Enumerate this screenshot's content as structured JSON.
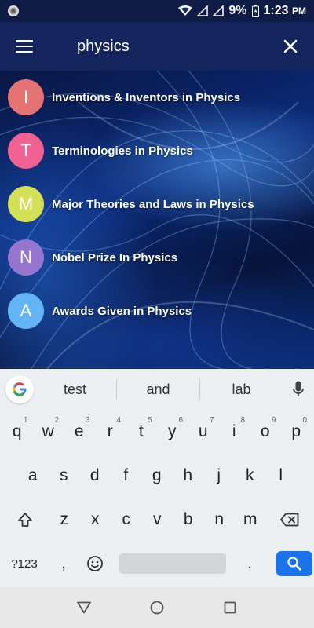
{
  "status_bar": {
    "battery": "9%",
    "time": "1:23",
    "ampm": "PM"
  },
  "app_bar": {
    "search_query": "physics"
  },
  "results": [
    {
      "letter": "I",
      "label": "Inventions & Inventors in Physics",
      "color": "#e57373"
    },
    {
      "letter": "T",
      "label": "Terminologies in Physics",
      "color": "#f06292"
    },
    {
      "letter": "M",
      "label": "Major Theories and Laws in Physics",
      "color": "#d4e157"
    },
    {
      "letter": "N",
      "label": "Nobel Prize In Physics",
      "color": "#9575cd"
    },
    {
      "letter": "A",
      "label": "Awards Given in Physics",
      "color": "#64b5f6"
    }
  ],
  "keyboard": {
    "suggestions": [
      "test",
      "and",
      "lab"
    ],
    "row1": [
      {
        "key": "q",
        "hint": "1"
      },
      {
        "key": "w",
        "hint": "2"
      },
      {
        "key": "e",
        "hint": "3"
      },
      {
        "key": "r",
        "hint": "4"
      },
      {
        "key": "t",
        "hint": "5"
      },
      {
        "key": "y",
        "hint": "6"
      },
      {
        "key": "u",
        "hint": "7"
      },
      {
        "key": "i",
        "hint": "8"
      },
      {
        "key": "o",
        "hint": "9"
      },
      {
        "key": "p",
        "hint": "0"
      }
    ],
    "row2": [
      "a",
      "s",
      "d",
      "f",
      "g",
      "h",
      "j",
      "k",
      "l"
    ],
    "row3": [
      "z",
      "x",
      "c",
      "v",
      "b",
      "n",
      "m"
    ],
    "symbols_label": "?123",
    "comma": ",",
    "period": "."
  },
  "colors": {
    "app_bar": "#14245c",
    "search_key": "#1a73e8"
  }
}
